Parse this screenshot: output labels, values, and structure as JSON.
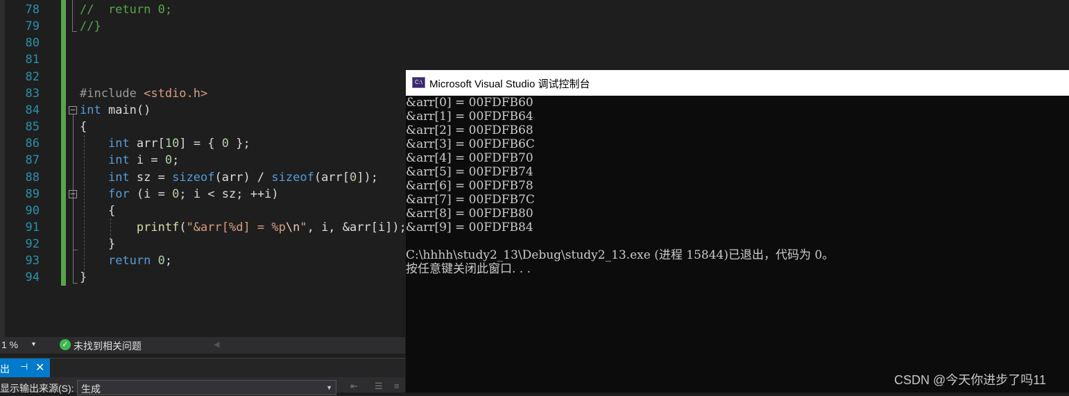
{
  "editor": {
    "lines": [
      {
        "n": "78",
        "tokens": [
          {
            "t": "//  return 0;",
            "c": "cm"
          }
        ]
      },
      {
        "n": "79",
        "tokens": [
          {
            "t": "//}",
            "c": "cm"
          }
        ]
      },
      {
        "n": "80",
        "tokens": []
      },
      {
        "n": "81",
        "tokens": []
      },
      {
        "n": "82",
        "tokens": []
      },
      {
        "n": "83",
        "tokens": [
          {
            "t": "#include ",
            "c": "pp"
          },
          {
            "t": "<stdio.h>",
            "c": "inc"
          }
        ]
      },
      {
        "n": "84",
        "tokens": [
          {
            "t": "int",
            "c": "kw"
          },
          {
            "t": " main()",
            "c": ""
          }
        ]
      },
      {
        "n": "85",
        "tokens": [
          {
            "t": "{",
            "c": ""
          }
        ]
      },
      {
        "n": "86",
        "tokens": [
          {
            "t": "    ",
            "c": ""
          },
          {
            "t": "int",
            "c": "kw"
          },
          {
            "t": " arr[",
            "c": ""
          },
          {
            "t": "10",
            "c": "num"
          },
          {
            "t": "] = { ",
            "c": ""
          },
          {
            "t": "0",
            "c": "num"
          },
          {
            "t": " };",
            "c": ""
          }
        ]
      },
      {
        "n": "87",
        "tokens": [
          {
            "t": "    ",
            "c": ""
          },
          {
            "t": "int",
            "c": "kw"
          },
          {
            "t": " i = ",
            "c": ""
          },
          {
            "t": "0",
            "c": "num"
          },
          {
            "t": ";",
            "c": ""
          }
        ]
      },
      {
        "n": "88",
        "tokens": [
          {
            "t": "    ",
            "c": ""
          },
          {
            "t": "int",
            "c": "kw"
          },
          {
            "t": " sz = ",
            "c": ""
          },
          {
            "t": "sizeof",
            "c": "kw"
          },
          {
            "t": "(arr) / ",
            "c": ""
          },
          {
            "t": "sizeof",
            "c": "kw"
          },
          {
            "t": "(arr[",
            "c": ""
          },
          {
            "t": "0",
            "c": "num"
          },
          {
            "t": "]);",
            "c": ""
          }
        ]
      },
      {
        "n": "89",
        "tokens": [
          {
            "t": "    ",
            "c": ""
          },
          {
            "t": "for",
            "c": "kw"
          },
          {
            "t": " (i = ",
            "c": ""
          },
          {
            "t": "0",
            "c": "num"
          },
          {
            "t": "; i < sz; ++i)",
            "c": ""
          }
        ]
      },
      {
        "n": "90",
        "tokens": [
          {
            "t": "    {",
            "c": ""
          }
        ]
      },
      {
        "n": "91",
        "tokens": [
          {
            "t": "        ",
            "c": ""
          },
          {
            "t": "printf",
            "c": "fn"
          },
          {
            "t": "(",
            "c": ""
          },
          {
            "t": "\"&arr[%d] = %p",
            "c": "str"
          },
          {
            "t": "\\n",
            "c": "esc"
          },
          {
            "t": "\"",
            "c": "str"
          },
          {
            "t": ", i, &arr[i]);",
            "c": ""
          }
        ]
      },
      {
        "n": "92",
        "tokens": [
          {
            "t": "    }",
            "c": ""
          }
        ]
      },
      {
        "n": "93",
        "tokens": [
          {
            "t": "    ",
            "c": ""
          },
          {
            "t": "return",
            "c": "kw"
          },
          {
            "t": " ",
            "c": ""
          },
          {
            "t": "0",
            "c": "num"
          },
          {
            "t": ";",
            "c": ""
          }
        ]
      },
      {
        "n": "94",
        "tokens": [
          {
            "t": "}",
            "c": ""
          }
        ]
      }
    ]
  },
  "status": {
    "zoom": "1 %",
    "issues_text": "未找到相关问题"
  },
  "output_panel": {
    "tab_label": "出",
    "source_label": "显示输出来源(S):",
    "source_value": "生成"
  },
  "console": {
    "title": "Microsoft Visual Studio 调试控制台",
    "icon_text": "C:\\",
    "lines": [
      "&arr[0] = 00FDFB60",
      "&arr[1] = 00FDFB64",
      "&arr[2] = 00FDFB68",
      "&arr[3] = 00FDFB6C",
      "&arr[4] = 00FDFB70",
      "&arr[5] = 00FDFB74",
      "&arr[6] = 00FDFB78",
      "&arr[7] = 00FDFB7C",
      "&arr[8] = 00FDFB80",
      "&arr[9] = 00FDFB84",
      "",
      "C:\\hhhh\\study2_13\\Debug\\study2_13.exe (进程 15844)已退出，代码为 0。",
      "按任意键关闭此窗口. . ."
    ]
  },
  "watermark": "CSDN @今天你进步了吗11"
}
